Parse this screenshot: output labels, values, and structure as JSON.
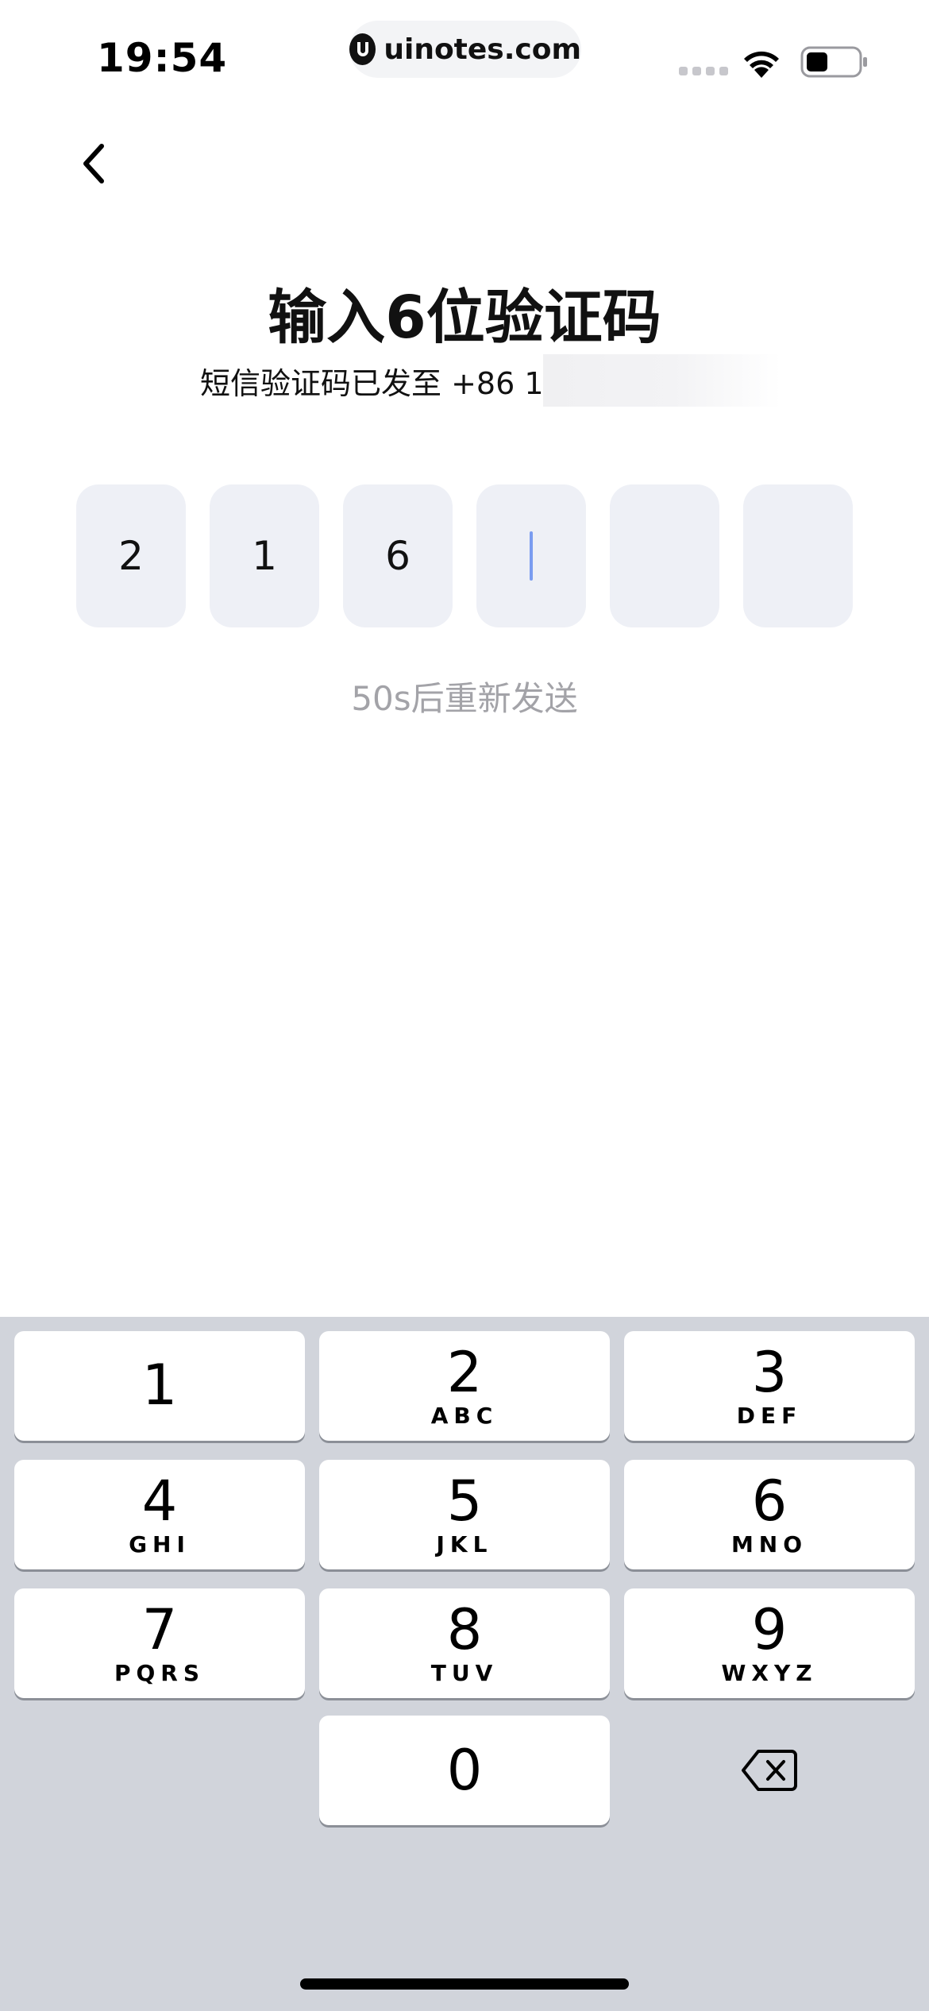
{
  "status_bar": {
    "time": "19:54",
    "url": "uinotes.com"
  },
  "header": {
    "title": "输入6位验证码",
    "subtitle": "短信验证码已发至 +86 1"
  },
  "code_input": {
    "digits": [
      "2",
      "1",
      "6",
      "",
      "",
      ""
    ],
    "active_index": 3
  },
  "resend": {
    "text": "50s后重新发送"
  },
  "keyboard": {
    "keys": [
      {
        "digit": "1",
        "letters": ""
      },
      {
        "digit": "2",
        "letters": "ABC"
      },
      {
        "digit": "3",
        "letters": "DEF"
      },
      {
        "digit": "4",
        "letters": "GHI"
      },
      {
        "digit": "5",
        "letters": "JKL"
      },
      {
        "digit": "6",
        "letters": "MNO"
      },
      {
        "digit": "7",
        "letters": "PQRS"
      },
      {
        "digit": "8",
        "letters": "TUV"
      },
      {
        "digit": "9",
        "letters": "WXYZ"
      },
      {
        "digit": "0",
        "letters": ""
      }
    ]
  },
  "colors": {
    "code_box_bg": "#eef0f6",
    "caret": "#7a9cf0",
    "keyboard_bg": "#d1d4db",
    "muted_text": "#a3a3a8"
  }
}
